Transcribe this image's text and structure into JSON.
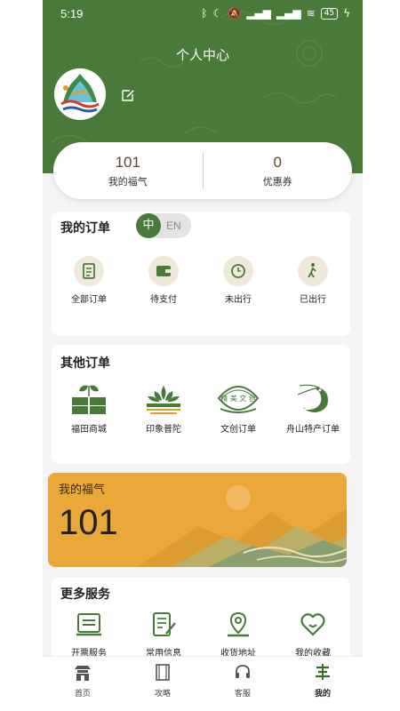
{
  "status_bar": {
    "time": "5:19",
    "battery": "45"
  },
  "header": {
    "title": "个人中心"
  },
  "stats": [
    {
      "value": "101",
      "label": "我的福气"
    },
    {
      "value": "0",
      "label": "优惠券"
    }
  ],
  "my_orders": {
    "title": "我的订单",
    "lang_zh": "中",
    "lang_en": "EN",
    "items": [
      {
        "label": "全部订单",
        "icon": "all-orders-icon"
      },
      {
        "label": "待支付",
        "icon": "wallet-icon"
      },
      {
        "label": "未出行",
        "icon": "clock-icon"
      },
      {
        "label": "已出行",
        "icon": "walking-icon"
      }
    ]
  },
  "other_orders": {
    "title": "其他订单",
    "items": [
      {
        "label": "福田商城",
        "icon": "sprout-icon"
      },
      {
        "label": "印象普陀",
        "icon": "lotus-icon"
      },
      {
        "label": "文创订单",
        "icon": "cultural-badge-icon"
      },
      {
        "label": "舟山特产订单",
        "icon": "shrimp-icon"
      }
    ],
    "badge_text": "精 美 文 创"
  },
  "fuqi": {
    "label": "我的福气",
    "value": "101"
  },
  "more_services": {
    "title": "更多服务",
    "items": [
      {
        "label": "开票服务",
        "icon": "invoice-icon"
      },
      {
        "label": "常用信息",
        "icon": "document-edit-icon"
      },
      {
        "label": "收货地址",
        "icon": "location-icon"
      },
      {
        "label": "我的收藏",
        "icon": "heart-icon"
      }
    ]
  },
  "tabbar": [
    {
      "label": "首页",
      "icon": "temple-icon"
    },
    {
      "label": "攻略",
      "icon": "book-icon"
    },
    {
      "label": "客服",
      "icon": "headset-icon"
    },
    {
      "label": "我的",
      "icon": "profile-icon",
      "active": true
    }
  ],
  "colors": {
    "primary": "#4a7a3a",
    "accent": "#eba83a",
    "background": "#f4f4f4"
  }
}
